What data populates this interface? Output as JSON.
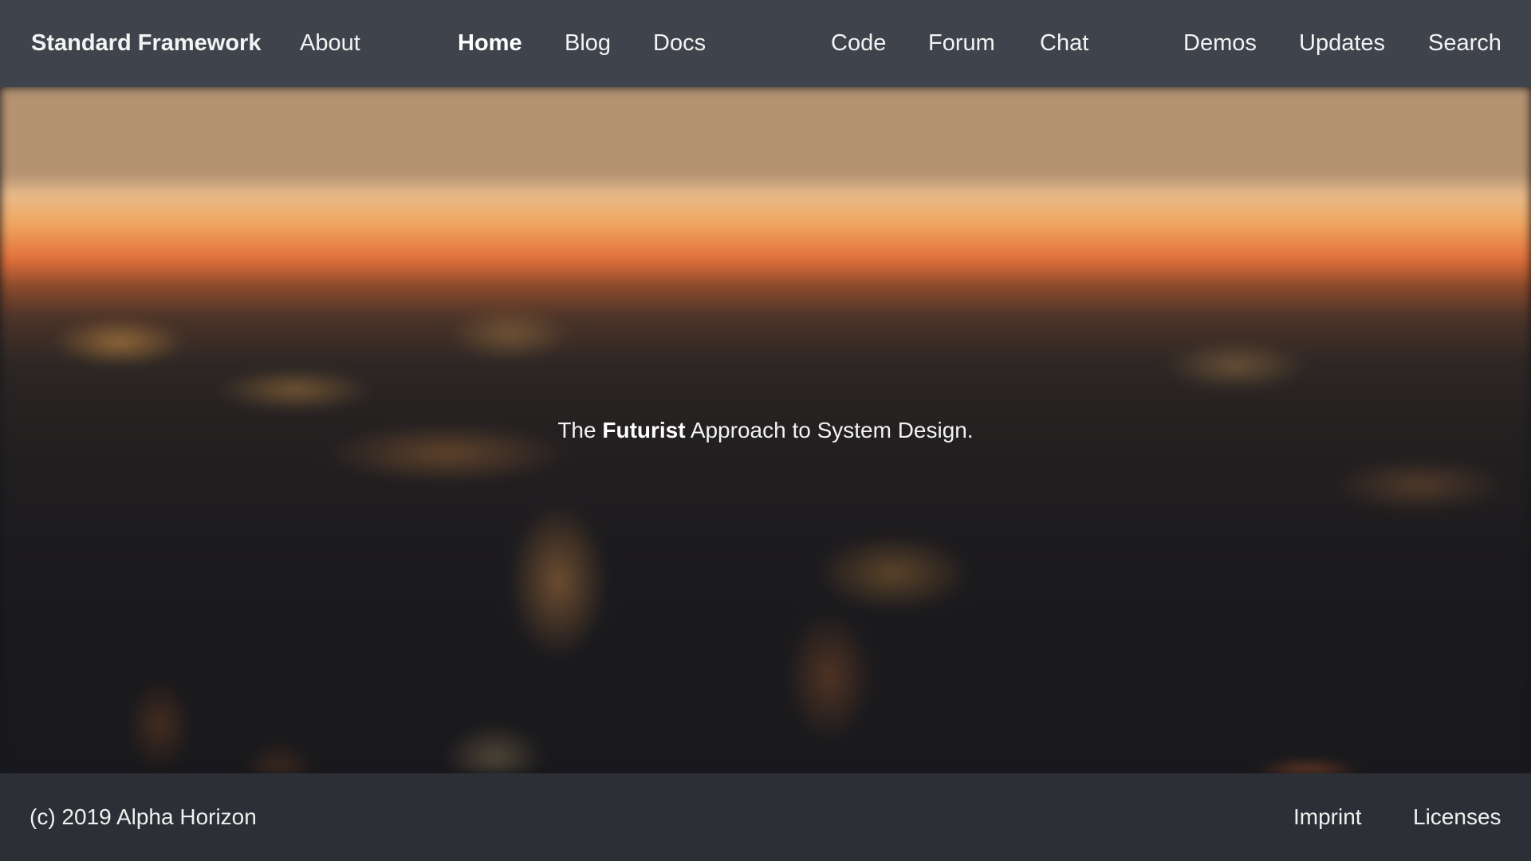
{
  "header": {
    "brand": "Standard Framework",
    "nav": {
      "about": "About",
      "home": "Home",
      "blog": "Blog",
      "docs": "Docs",
      "code": "Code",
      "forum": "Forum",
      "chat": "Chat",
      "demos": "Demos",
      "updates": "Updates",
      "search": "Search"
    },
    "active": "Home"
  },
  "hero": {
    "tagline_prefix": "The ",
    "tagline_emphasis": "Futurist",
    "tagline_suffix": " Approach to System Design."
  },
  "footer": {
    "copyright": "(c) 2019 Alpha Horizon",
    "imprint": "Imprint",
    "licenses": "Licenses"
  },
  "colors": {
    "header_bg": "#3e434c",
    "footer_bg": "#2c2f35",
    "text": "#ffffff"
  }
}
